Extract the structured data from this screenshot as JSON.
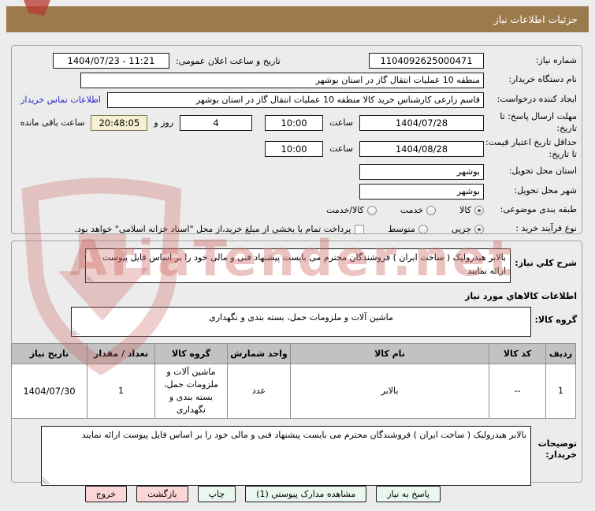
{
  "colors": {
    "titlebar": "#9b7a4b",
    "button_green": "#e9f7ee",
    "button_pink": "#fbd6d6",
    "countdown_bg": "#f5f0d2",
    "link_blue": "#2626cf",
    "table_header_bg": "#c2c2c2",
    "watermark_pink": "#cd6862"
  },
  "title_bar": {
    "title": "جزئیات اطلاعات نیاز"
  },
  "watermark": {
    "text": "AriaTender.net"
  },
  "form": {
    "need_number": {
      "label": "شماره نیاز:",
      "value": "1104092625000471"
    },
    "announce": {
      "label": "تاریخ و ساعت اعلان عمومی:",
      "value": "1404/07/23 - 11:21"
    },
    "buyer_org": {
      "label": "نام دستگاه خریدار:",
      "value": "منطقه 10 عملیات انتقال گاز در استان بوشهر"
    },
    "creator": {
      "label": "ایجاد کننده درخواست:",
      "value": "قاسم زارعی کارشناس خرید کالا منطقه 10 عملیات انتقال گاز در استان بوشهر",
      "contact_link": "اطلاعات تماس خریدار"
    },
    "deadline": {
      "label": "مهلت ارسال پاسخ: تا تاریخ:",
      "date": "1404/07/28",
      "hour_label": "ساعت",
      "time": "10:00",
      "days": "4",
      "days_label": "روز و",
      "remaining": "20:48:05",
      "remaining_label": "ساعت باقی مانده"
    },
    "price_validity": {
      "label": "حداقل تاریخ اعتبار قیمت: تا تاریخ:",
      "date": "1404/08/28",
      "hour_label": "ساعت",
      "time": "10:00"
    },
    "province": {
      "label": "استان محل تحویل:",
      "value": "بوشهر"
    },
    "city": {
      "label": "شهر محل تحویل:",
      "value": "بوشهر"
    },
    "subject_class": {
      "label": "طبقه بندی موضوعی:",
      "options": [
        {
          "label": "کالا",
          "selected": true
        },
        {
          "label": "خدمت",
          "selected": false
        },
        {
          "label": "کالا/خدمت",
          "selected": false
        }
      ]
    },
    "process_type": {
      "label": "نوع فرآیند خرید :",
      "options": [
        {
          "label": "جزیی",
          "selected": true
        },
        {
          "label": "متوسط",
          "selected": false
        }
      ],
      "checkbox": {
        "label": "پرداخت تمام یا بخشی از مبلغ خرید،از محل \"اسناد خزانه اسلامی\" خواهد بود.",
        "checked": false
      }
    }
  },
  "need_description": {
    "label": "شرح کلي نیاز:",
    "value": "بالابر هیدرولیک ( ساخت ایران ) فروشندگان محترم می بایست پیشنهاد فنی و مالی خود را بر اساس فایل پیوست ارائه نمایند"
  },
  "items_section": {
    "header": "اطلاعات کالاهاي مورد نیاز",
    "group": {
      "label": "گروه کالا:",
      "value": "ماشین آلات و ملزومات حمل، بسته بندی و نگهداری"
    },
    "table": {
      "headers": [
        "ردیف",
        "کد کالا",
        "نام کالا",
        "واحد شمارش",
        "گروه کالا",
        "تعداد / مقدار",
        "تاریخ نیاز"
      ],
      "rows": [
        [
          "1",
          "--",
          "بالابر",
          "عدد",
          "ماشین آلات و ملزومات حمل، بسته بندی و نگهداری",
          "1",
          "1404/07/30"
        ]
      ]
    },
    "buyer_notes": {
      "label": "توضیحات خریدار:",
      "value": "بالابر هیدرولیک ( ساخت ایران ) فروشندگان محترم می بایست پیشنهاد فنی و مالی خود را بر اساس فایل پیوست ارائه نمایند"
    }
  },
  "buttons": [
    {
      "label": "پاسخ به نیاز",
      "style": "green"
    },
    {
      "label": "مشاهده مدارک پیوستي (1)",
      "style": "green"
    },
    {
      "label": "چاپ",
      "style": "green"
    },
    {
      "label": "بازگشت",
      "style": "pink"
    },
    {
      "label": "خروج",
      "style": "pink"
    }
  ]
}
